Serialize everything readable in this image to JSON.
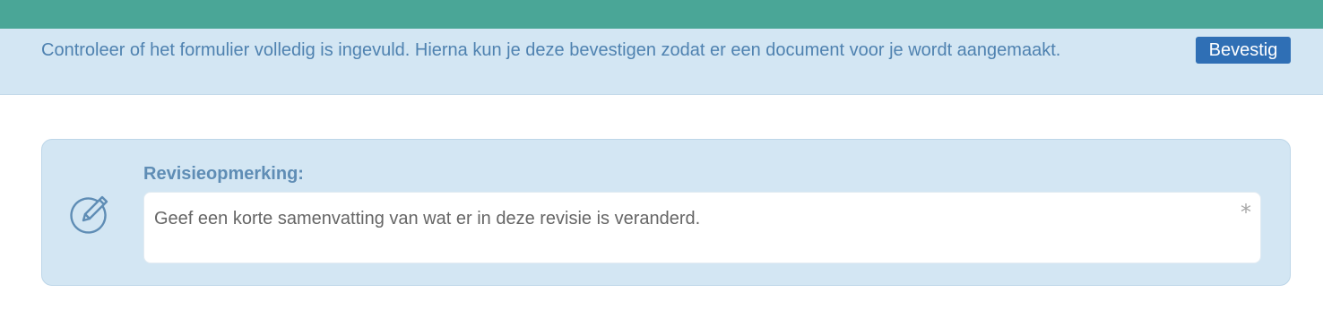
{
  "notice": {
    "text": "Controleer of het formulier volledig is ingevuld. Hierna kun je deze bevestigen zodat er een document voor je wordt aangemaakt.",
    "confirm_label": "Bevestig"
  },
  "revision": {
    "label": "Revisieopmerking:",
    "placeholder": "Geef een korte samenvatting van wat er in deze revisie is veranderd.",
    "value": "",
    "required_mark": "*",
    "icon": "edit-pencil-circle-icon"
  },
  "colors": {
    "topbar": "#4aa697",
    "notice_bg": "#d3e6f3",
    "notice_text": "#4f82b0",
    "button_bg": "#2f6fb5",
    "label": "#5f8db5"
  }
}
